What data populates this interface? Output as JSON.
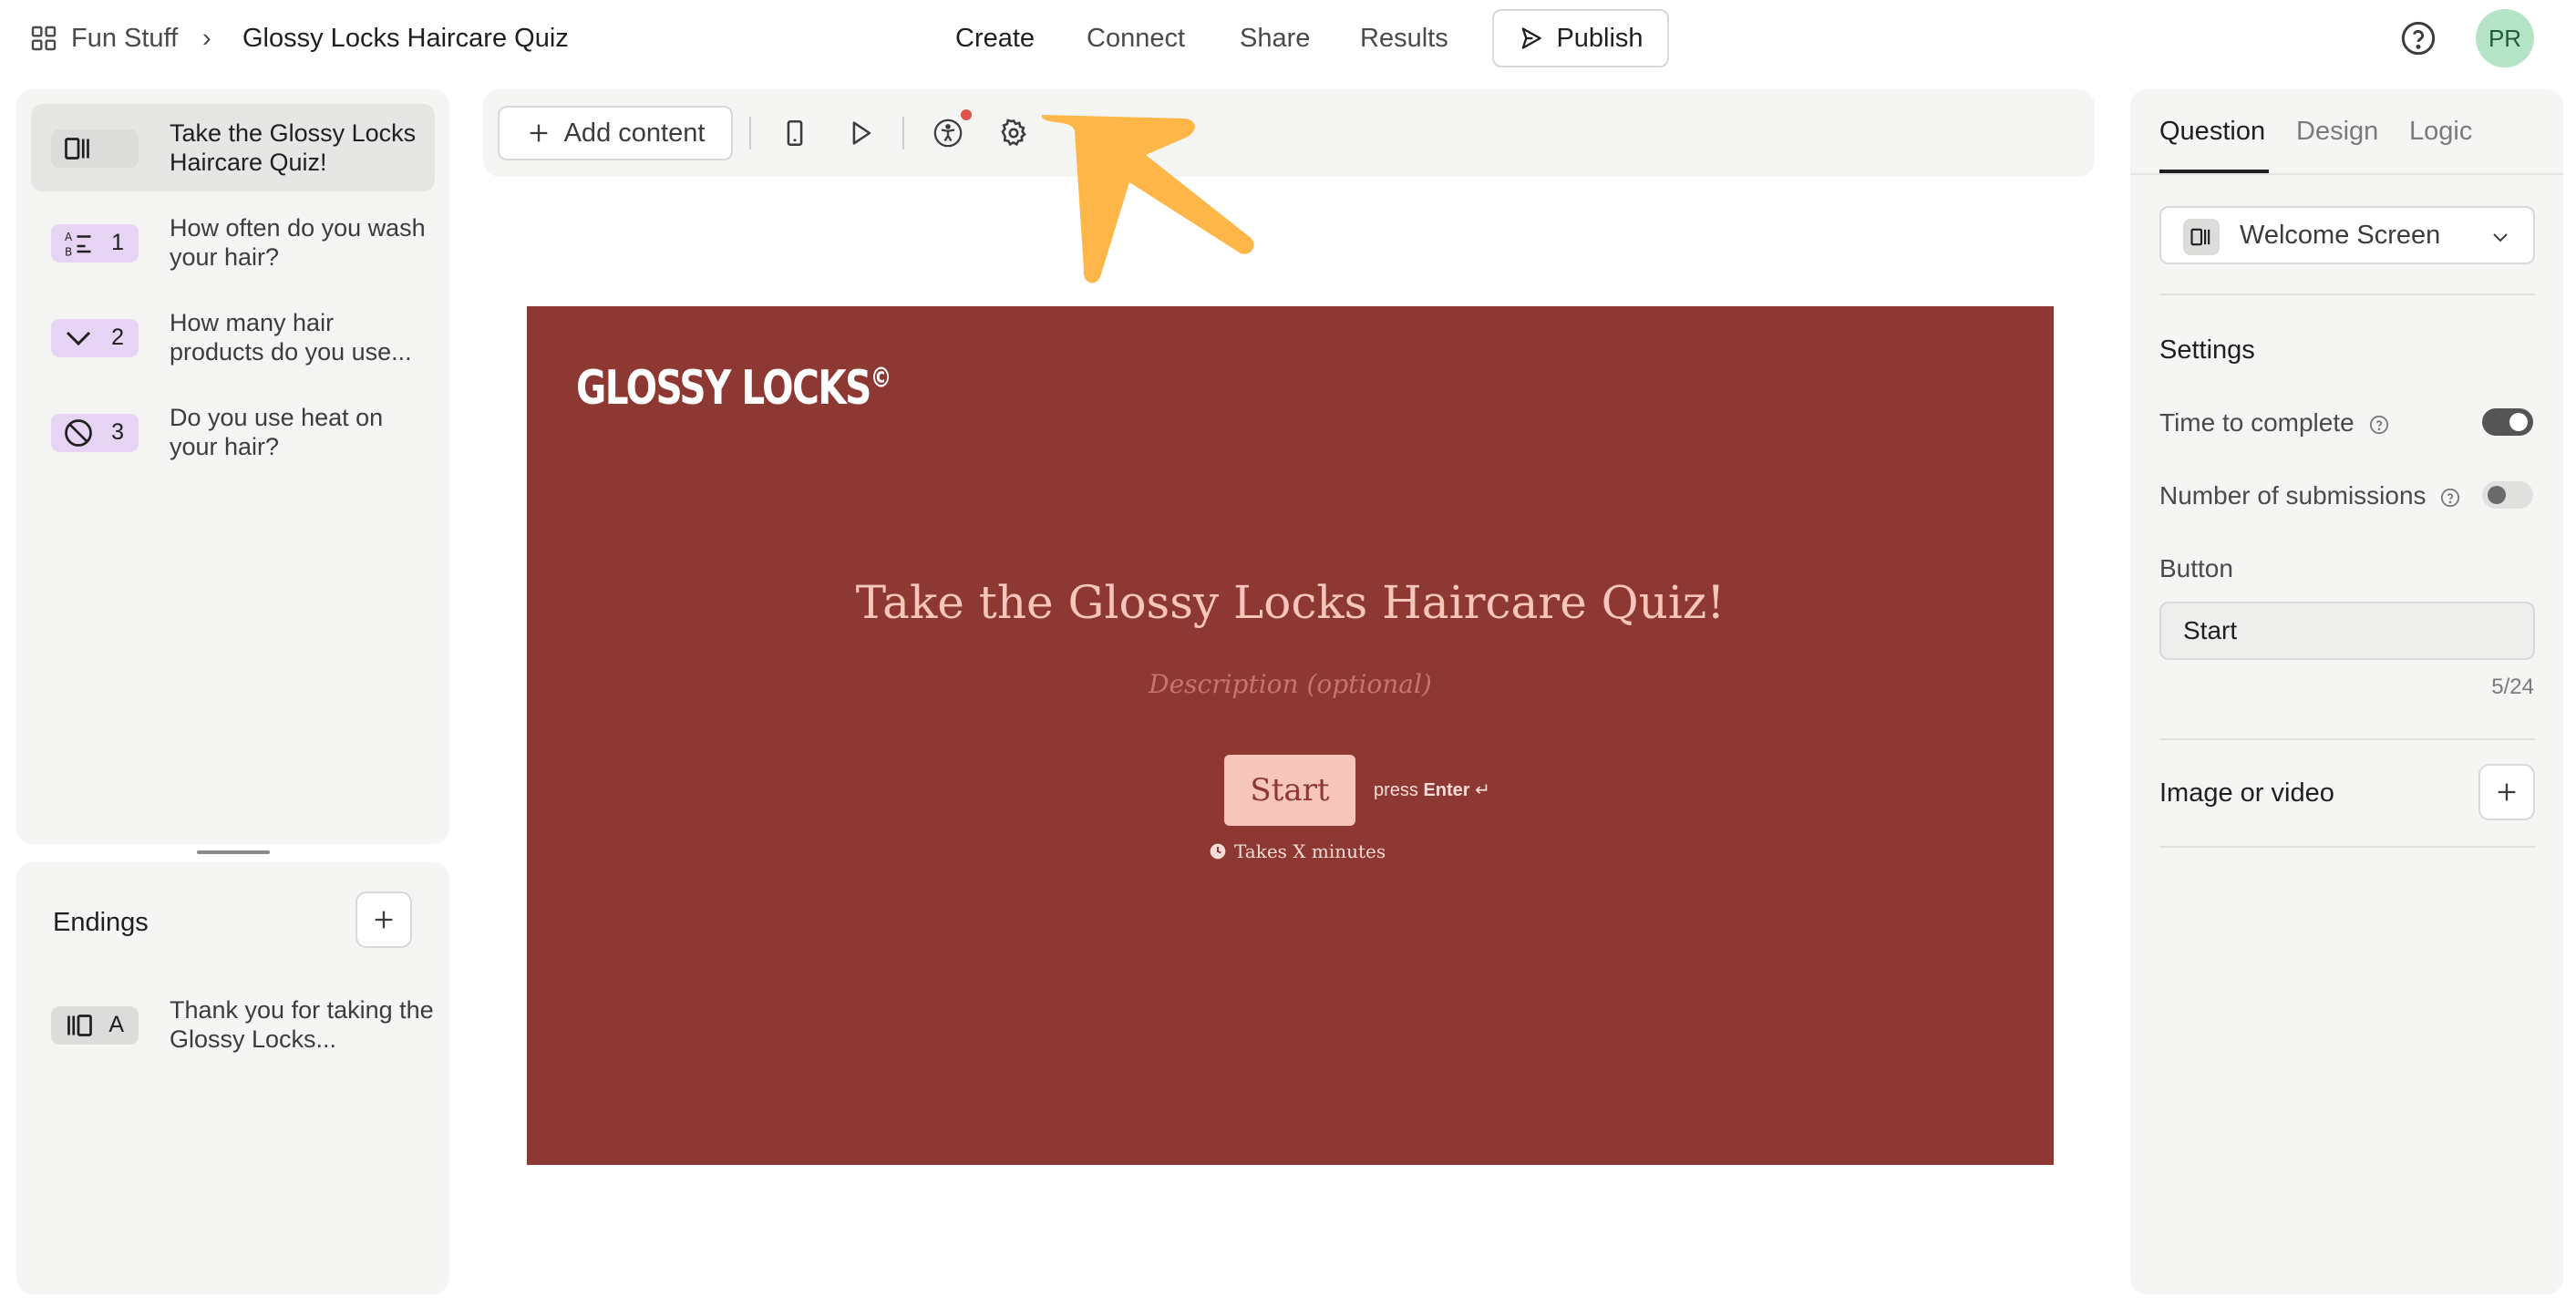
{
  "header": {
    "workspace": "Fun Stuff",
    "separator": "›",
    "form_title": "Glossy Locks Haircare Quiz",
    "nav": {
      "create": "Create",
      "connect": "Connect",
      "share": "Share",
      "results": "Results"
    },
    "publish_label": "Publish",
    "avatar_initials": "PR"
  },
  "questions": [
    {
      "icon": "welcome-screen-icon",
      "number": "",
      "text": "Take the Glossy Locks Haircare Quiz!",
      "active": true
    },
    {
      "icon": "ranking-icon",
      "number": "1",
      "text": "How often do you wash your hair?"
    },
    {
      "icon": "dropdown-chevron-icon",
      "number": "2",
      "text": "How many hair products do you use..."
    },
    {
      "icon": "no-heat-icon",
      "number": "3",
      "text": "Do you use heat on your hair?"
    }
  ],
  "endings": {
    "title": "Endings",
    "items": [
      {
        "icon": "ending-screen-icon",
        "letter": "A",
        "text": "Thank you for taking the Glossy Locks..."
      }
    ]
  },
  "toolbar": {
    "add_content_label": "Add content",
    "icons": [
      "mobile-preview-icon",
      "play-preview-icon",
      "accessibility-icon",
      "settings-gear-icon"
    ]
  },
  "preview": {
    "brand": "GLOSSY LOCKS",
    "brand_mark": "©",
    "title": "Take the Glossy Locks Haircare Quiz!",
    "description_placeholder": "Description (optional)",
    "start_label": "Start",
    "press_label": "press",
    "enter_label": "Enter",
    "enter_glyph": "↵",
    "takes_label": "Takes X minutes",
    "background_color": "#8e3833",
    "accent_color": "#f7c5bc"
  },
  "right_panel": {
    "tabs": [
      "Question",
      "Design",
      "Logic"
    ],
    "active_tab": "Question",
    "type_select_label": "Welcome Screen",
    "settings_heading": "Settings",
    "time_to_complete_label": "Time to complete",
    "time_to_complete_enabled": true,
    "submissions_label": "Number of submissions",
    "submissions_enabled": false,
    "button_heading": "Button",
    "button_value": "Start",
    "button_counter": "5/24",
    "media_heading": "Image or video"
  },
  "annotation": {
    "arrow_color": "#ffb648"
  }
}
